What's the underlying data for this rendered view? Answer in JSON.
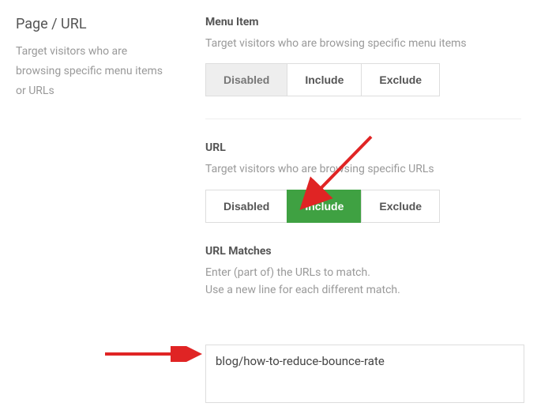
{
  "sidebar": {
    "title": "Page / URL",
    "description": "Target visitors who are browsing specific menu items or URLs"
  },
  "menu_item": {
    "label": "Menu Item",
    "hint": "Target visitors who are browsing specific menu items",
    "buttons": {
      "disabled": "Disabled",
      "include": "Include",
      "exclude": "Exclude"
    }
  },
  "url": {
    "label": "URL",
    "hint": "Target visitors who are browsing specific URLs",
    "buttons": {
      "disabled": "Disabled",
      "include": "Include",
      "exclude": "Exclude"
    }
  },
  "url_matches": {
    "label": "URL Matches",
    "hint1": "Enter (part of) the URLs to match.",
    "hint2": "Use a new line for each different match.",
    "value": "blog/how-to-reduce-bounce-rate"
  }
}
